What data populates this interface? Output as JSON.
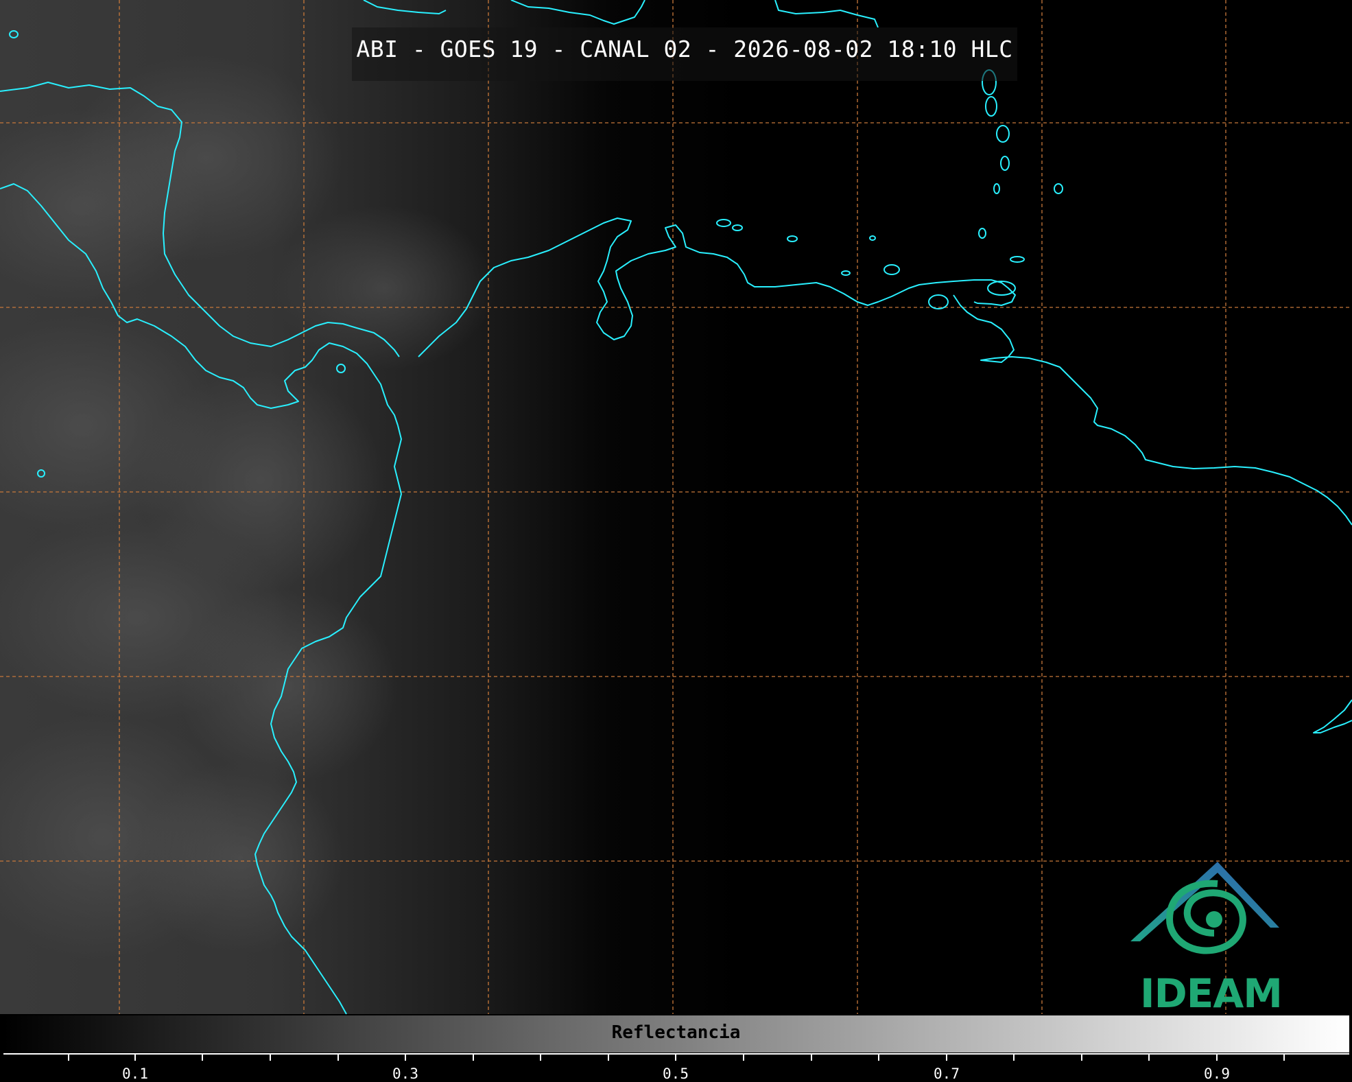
{
  "title": "ABI - GOES 19 - CANAL 02 - 2026-08-02 18:10 HLC",
  "colorbar": {
    "label": "Reflectancia",
    "ticks": [
      "0.1",
      "0.3",
      "0.5",
      "0.7",
      "0.9"
    ],
    "min": 0.0,
    "max": 1.0,
    "gradient": [
      "#000000",
      "#ffffff"
    ]
  },
  "logo": {
    "text": "IDEAM"
  },
  "colors": {
    "coastline": "#29f0ff",
    "grid": "#c8783a",
    "background": "#000000",
    "logo_green": "#1fa874",
    "logo_blue": "#2e6fb5"
  }
}
